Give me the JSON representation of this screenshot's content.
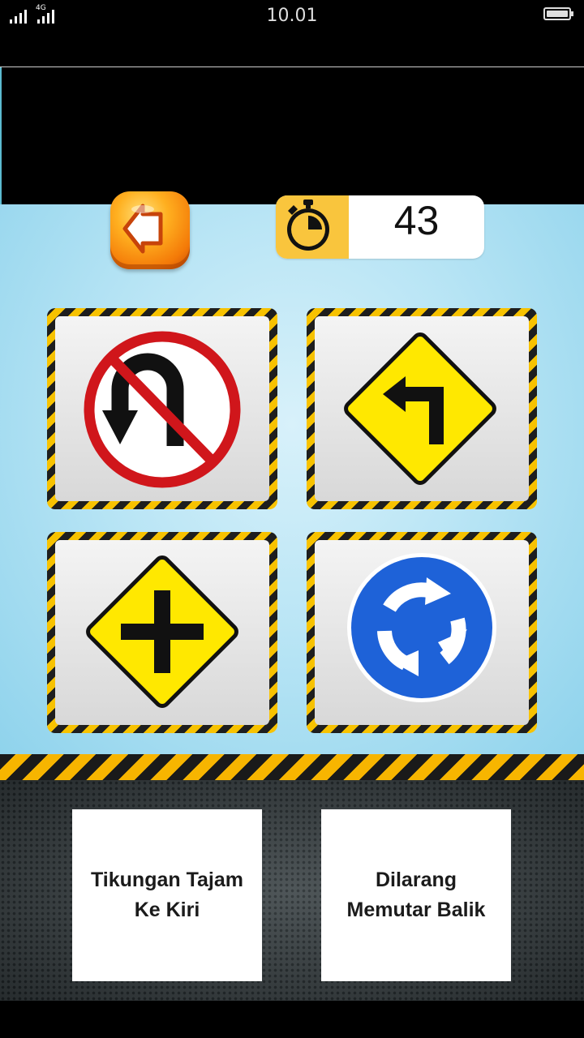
{
  "status_bar": {
    "network": "4G",
    "time": "10.01"
  },
  "timer": {
    "value": "43",
    "icon": "stopwatch-icon"
  },
  "back_button": {
    "icon": "arrow-left-icon"
  },
  "signs": [
    {
      "name": "no-u-turn-sign"
    },
    {
      "name": "sharp-left-turn-sign"
    },
    {
      "name": "crossroad-sign"
    },
    {
      "name": "roundabout-sign"
    }
  ],
  "answers": [
    {
      "label": "Tikungan Tajam Ke Kiri"
    },
    {
      "label": "Dilarang Memutar Balik"
    }
  ],
  "colors": {
    "warning_yellow": "#ffe800",
    "prohibition_red": "#d0161b",
    "mandatory_blue": "#1e62d8",
    "timer_accent": "#f9c53d",
    "button_orange": "#f47a08"
  }
}
